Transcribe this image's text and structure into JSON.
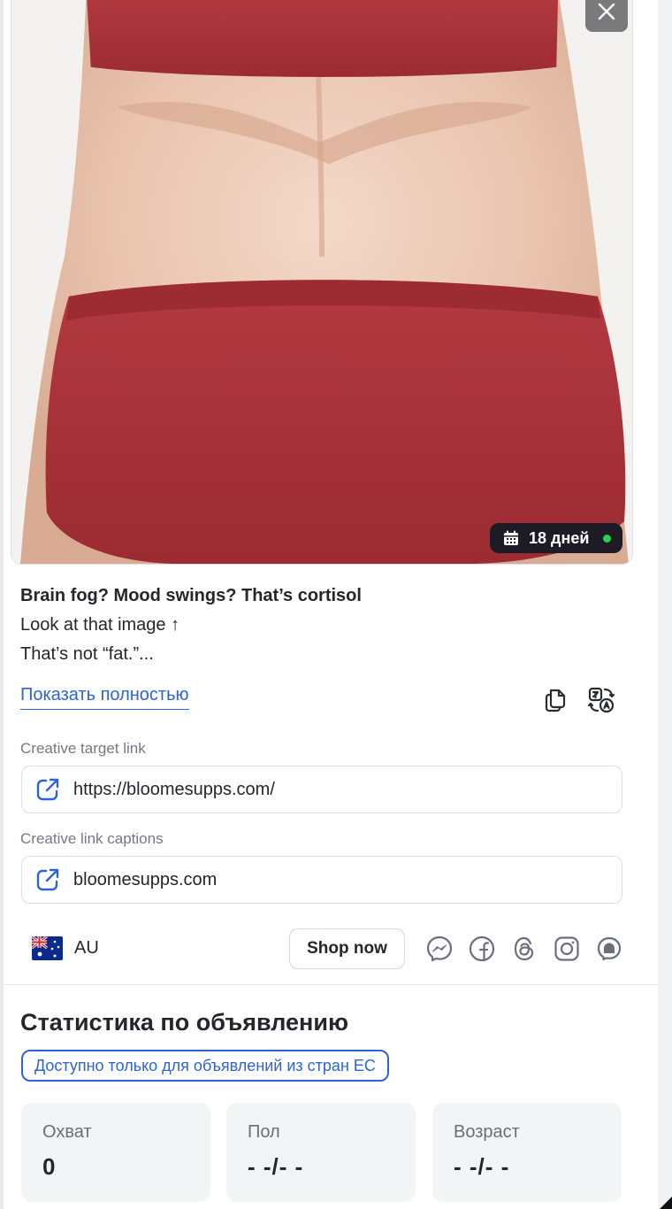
{
  "ad": {
    "duration_badge": "18 дней",
    "headline": "Brain fog? Mood swings? That’s cortisol",
    "body_lines": [
      "Look at that image ↑",
      "That’s not “fat.”..."
    ],
    "show_more_label": "Показать полностью"
  },
  "links": {
    "target_label": "Creative target link",
    "target_url": "https://bloomesupps.com/",
    "caption_label": "Creative link captions",
    "caption_value": "bloomesupps.com"
  },
  "meta": {
    "country": "AU",
    "cta_label": "Shop now",
    "platform_icons": [
      "messenger-icon",
      "facebook-icon",
      "threads-icon",
      "instagram-icon",
      "audience-network-icon"
    ]
  },
  "stats": {
    "title": "Статистика по объявлению",
    "eu_notice": "Доступно только для объявлений из стран ЕС",
    "cards": [
      {
        "label": "Охват",
        "value": "0"
      },
      {
        "label": "Пол",
        "value": "- -/- -"
      },
      {
        "label": "Возраст",
        "value": "- -/- -"
      }
    ]
  },
  "colors": {
    "accent": "#2e63d8",
    "badge_bg": "#1d1b26",
    "status_dot": "#2fd04d",
    "card_bg": "#f3f4f6"
  }
}
